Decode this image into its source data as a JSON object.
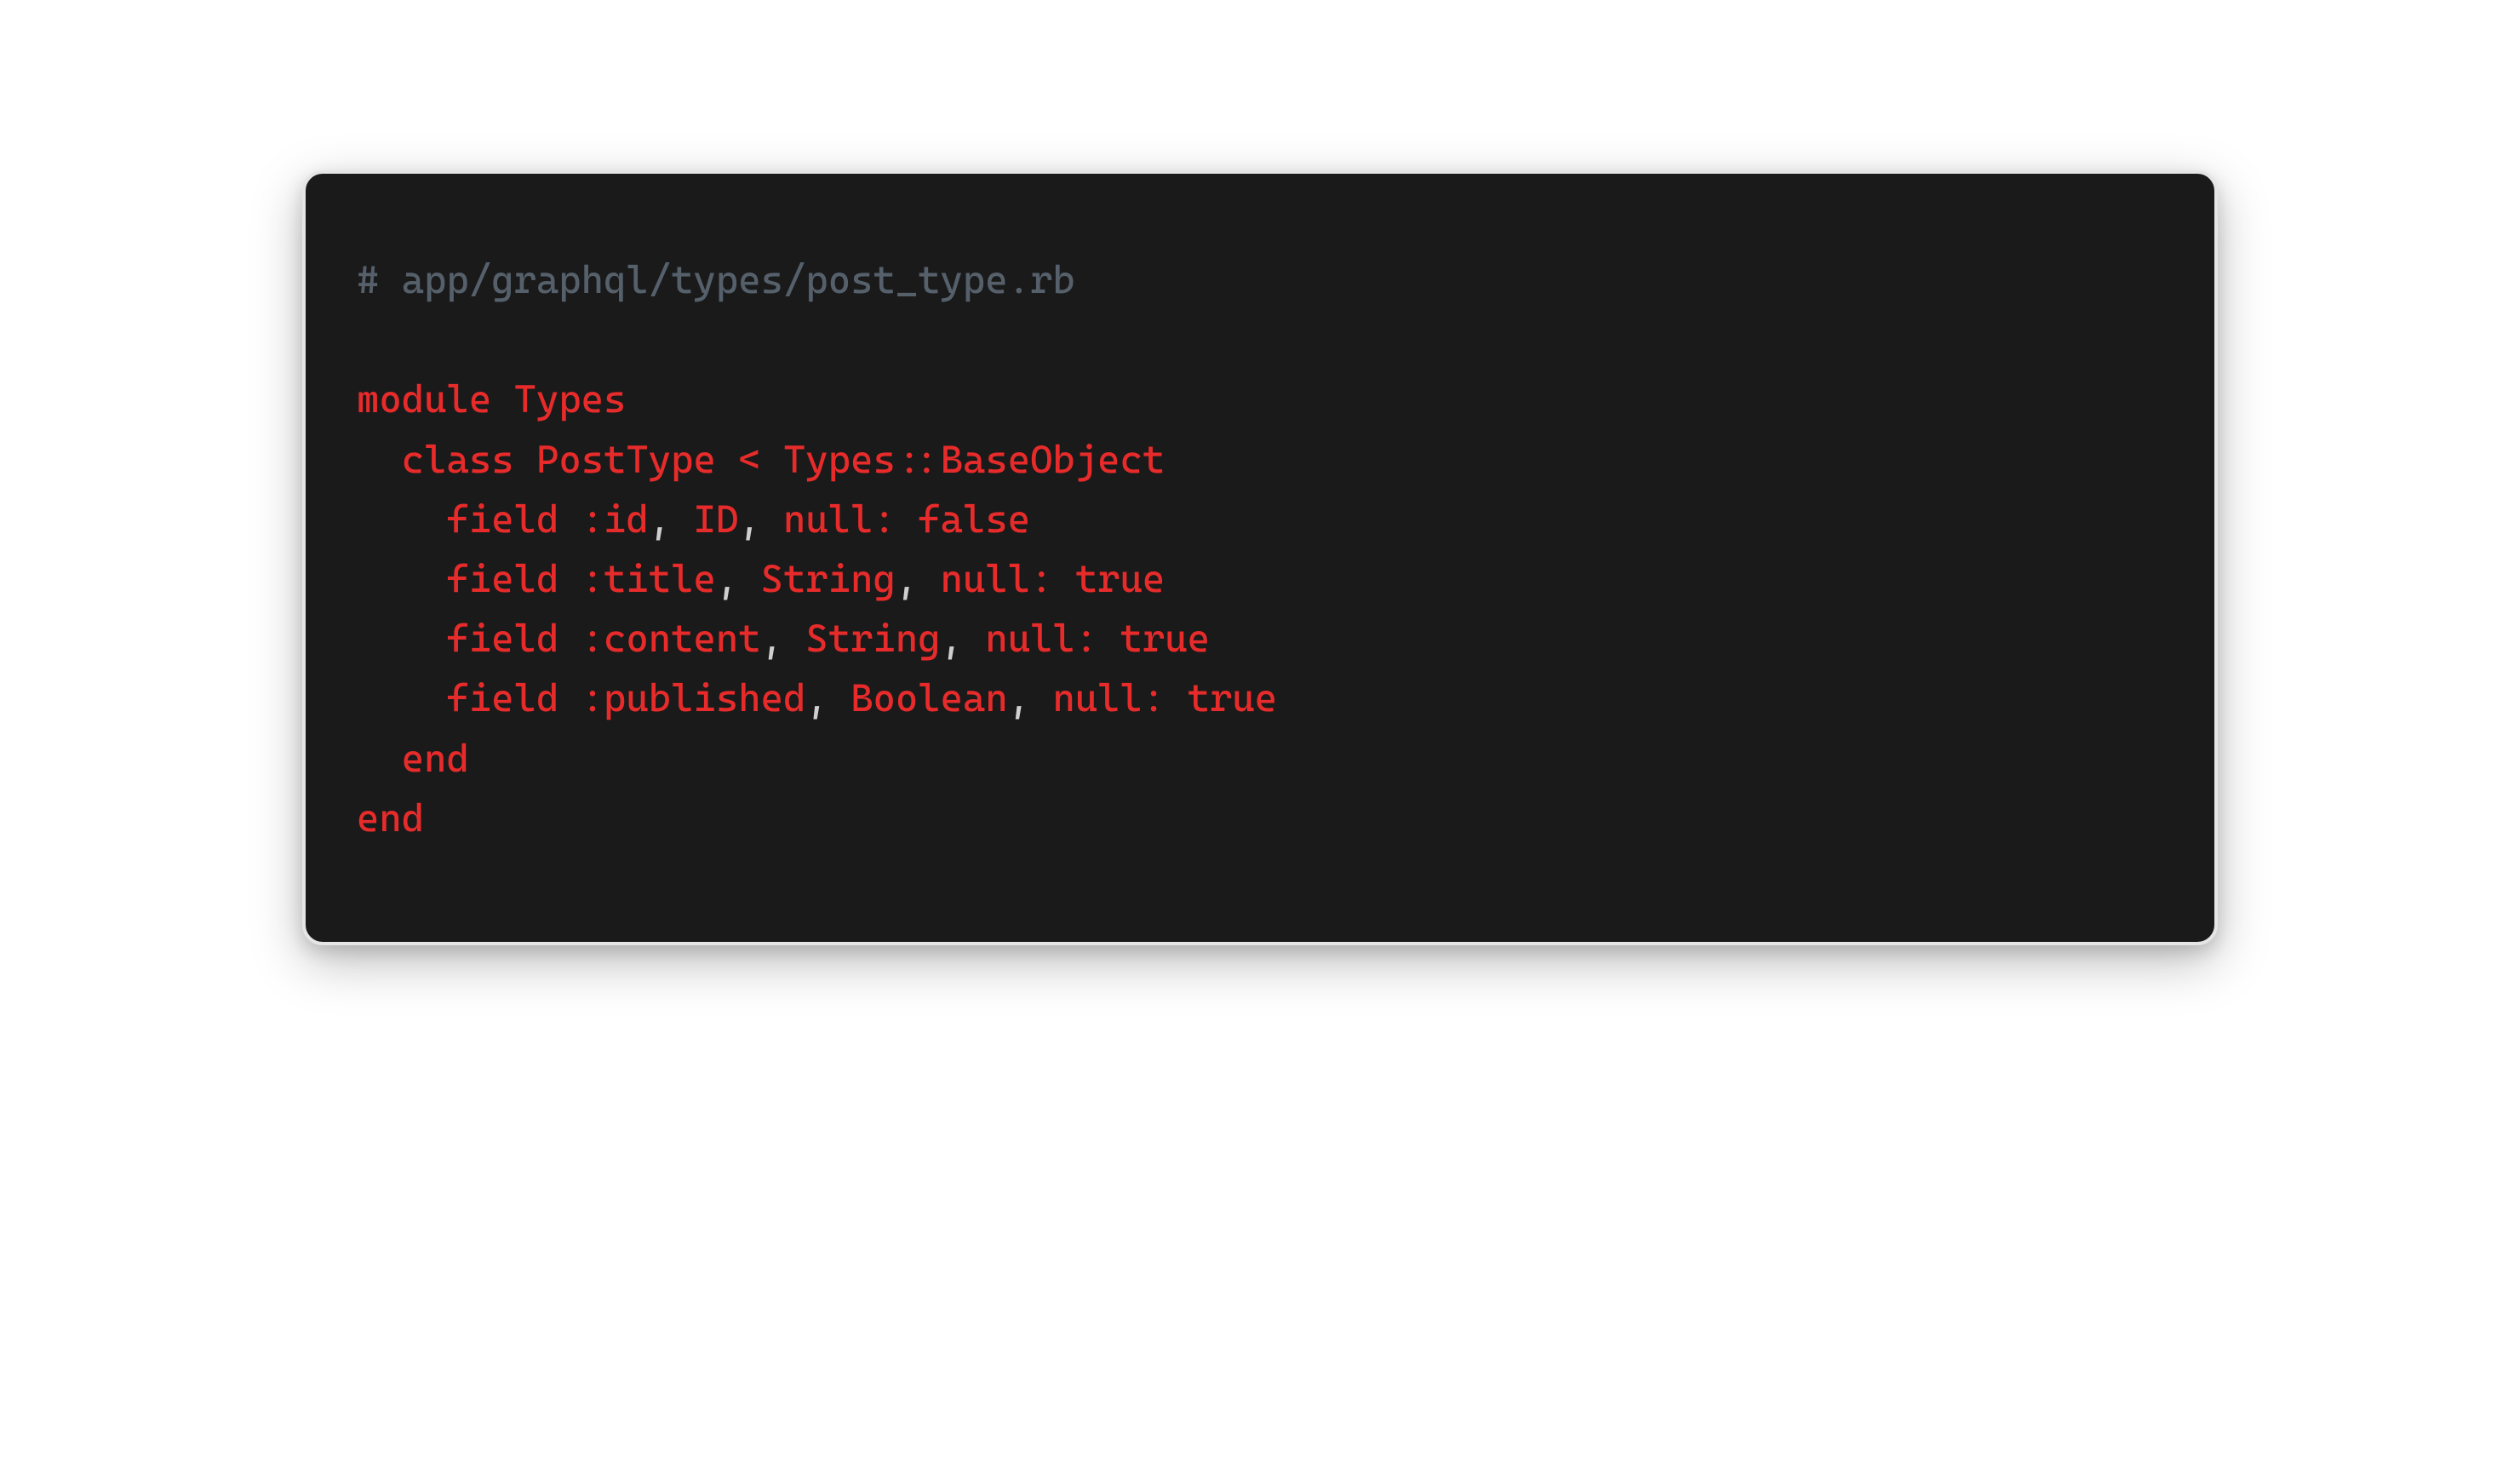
{
  "code": {
    "comment": "# app/graphql/types/post_type.rb",
    "kw_module": "module",
    "module_name": "Types",
    "kw_class": "class",
    "class_name": "PostType",
    "op_lt": "<",
    "base_scope": "Types",
    "scope_op": "::",
    "base_class": "BaseObject",
    "field_kw": "field",
    "nullkw": "null:",
    "true": "true",
    "false": "false",
    "fields": [
      {
        "name": ":id",
        "type": "ID",
        "nullable": "false"
      },
      {
        "name": ":title",
        "type": "String",
        "nullable": "true"
      },
      {
        "name": ":content",
        "type": "String",
        "nullable": "true"
      },
      {
        "name": ":published",
        "type": "Boolean",
        "nullable": "true"
      }
    ],
    "kw_end": "end",
    "comma": ",",
    "space": " "
  }
}
